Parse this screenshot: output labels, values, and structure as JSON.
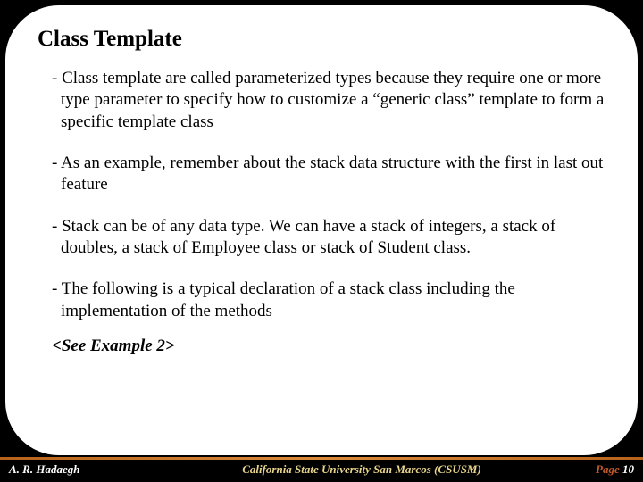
{
  "title": "Class Template",
  "bullets": [
    "- Class template are called parameterized types because they require one or more type parameter to specify how to customize a “generic class” template to form a specific template class",
    "- As an example, remember about the stack data structure with the first in last out feature",
    "- Stack can be of any data type. We can have a stack of integers, a stack of doubles, a stack of Employee class  or stack of Student class.",
    "- The following is a typical declaration of a stack class including the implementation of the methods"
  ],
  "see_example": "<See Example 2>",
  "footer": {
    "author": "A. R. Hadaegh",
    "affiliation": "California State University San Marcos (CSUSM)",
    "page_label": "Page",
    "page_number": "10"
  }
}
